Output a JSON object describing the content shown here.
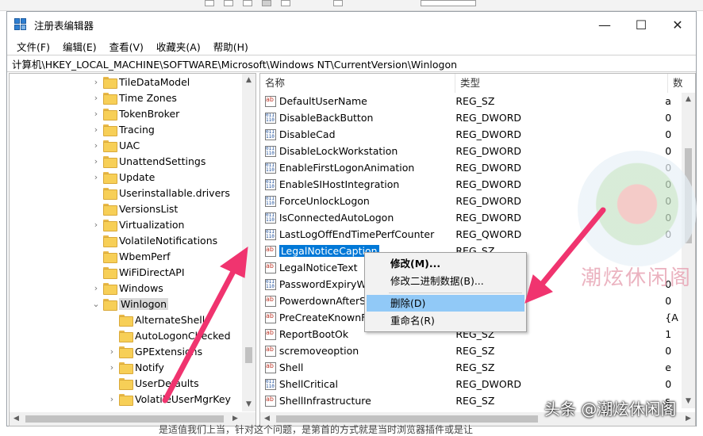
{
  "window": {
    "title": "注册表编辑器",
    "minimize": "—",
    "maximize": "☐",
    "close": "✕"
  },
  "menu": [
    "文件(F)",
    "编辑(E)",
    "查看(V)",
    "收藏夹(A)",
    "帮助(H)"
  ],
  "address": "计算机\\HKEY_LOCAL_MACHINE\\SOFTWARE\\Microsoft\\Windows NT\\CurrentVersion\\Winlogon",
  "tree": {
    "items": [
      {
        "label": "TileDataModel",
        "expander": "›"
      },
      {
        "label": "Time Zones",
        "expander": "›"
      },
      {
        "label": "TokenBroker",
        "expander": "›"
      },
      {
        "label": "Tracing",
        "expander": "›"
      },
      {
        "label": "UAC",
        "expander": "›"
      },
      {
        "label": "UnattendSettings",
        "expander": "›"
      },
      {
        "label": "Update",
        "expander": "›"
      },
      {
        "label": "Userinstallable.drivers",
        "expander": ""
      },
      {
        "label": "VersionsList",
        "expander": ""
      },
      {
        "label": "Virtualization",
        "expander": "›"
      },
      {
        "label": "VolatileNotifications",
        "expander": ""
      },
      {
        "label": "WbemPerf",
        "expander": ""
      },
      {
        "label": "WiFiDirectAPI",
        "expander": ""
      },
      {
        "label": "Windows",
        "expander": "›"
      },
      {
        "label": "Winlogon",
        "expander": "⌄"
      },
      {
        "label": "AlternateShells",
        "expander": ""
      },
      {
        "label": "AutoLogonChecked",
        "expander": ""
      },
      {
        "label": "GPExtensions",
        "expander": "›"
      },
      {
        "label": "Notify",
        "expander": "›"
      },
      {
        "label": "UserDefaults",
        "expander": ""
      },
      {
        "label": "VolatileUserMgrKey",
        "expander": "›"
      }
    ]
  },
  "list": {
    "headers": {
      "name": "名称",
      "type": "类型",
      "data": "数"
    },
    "rows": [
      {
        "name": "DefaultUserName",
        "type": "REG_SZ",
        "data": "a",
        "icon": "sz"
      },
      {
        "name": "DisableBackButton",
        "type": "REG_DWORD",
        "data": "0",
        "icon": "bin"
      },
      {
        "name": "DisableCad",
        "type": "REG_DWORD",
        "data": "0",
        "icon": "bin"
      },
      {
        "name": "DisableLockWorkstation",
        "type": "REG_DWORD",
        "data": "0",
        "icon": "bin"
      },
      {
        "name": "EnableFirstLogonAnimation",
        "type": "REG_DWORD",
        "data": "0",
        "icon": "bin"
      },
      {
        "name": "EnableSIHostIntegration",
        "type": "REG_DWORD",
        "data": "0",
        "icon": "bin"
      },
      {
        "name": "ForceUnlockLogon",
        "type": "REG_DWORD",
        "data": "0",
        "icon": "bin"
      },
      {
        "name": "IsConnectedAutoLogon",
        "type": "REG_DWORD",
        "data": "0",
        "icon": "bin"
      },
      {
        "name": "LastLogOffEndTimePerfCounter",
        "type": "REG_QWORD",
        "data": "0",
        "icon": "bin"
      },
      {
        "name": "LegalNoticeCaption",
        "type": "REG_SZ",
        "data": "",
        "icon": "sz"
      },
      {
        "name": "LegalNoticeText",
        "type": "",
        "data": "",
        "icon": "sz"
      },
      {
        "name": "PasswordExpiryWar",
        "type": "",
        "data": "0",
        "icon": "bin"
      },
      {
        "name": "PowerdownAfterShu",
        "type": "",
        "data": "0",
        "icon": "sz"
      },
      {
        "name": "PreCreateKnownFold",
        "type": "",
        "data": "{A",
        "icon": "sz"
      },
      {
        "name": "ReportBootOk",
        "type": "REG_SZ",
        "data": "1",
        "icon": "sz"
      },
      {
        "name": "scremoveoption",
        "type": "REG_SZ",
        "data": "0",
        "icon": "sz"
      },
      {
        "name": "Shell",
        "type": "REG_SZ",
        "data": "e",
        "icon": "sz"
      },
      {
        "name": "ShellCritical",
        "type": "REG_DWORD",
        "data": "0",
        "icon": "bin"
      },
      {
        "name": "ShellInfrastructure",
        "type": "REG_SZ",
        "data": "s",
        "icon": "sz"
      }
    ]
  },
  "context_menu": {
    "modify": "修改(M)...",
    "modify_binary": "修改二进制数据(B)...",
    "delete": "删除(D)",
    "rename": "重命名(R)"
  },
  "watermark": {
    "logo_text": "潮炫休闲阁",
    "bottom": "头条 @潮炫休闲阁"
  },
  "bottom_text": "是适值我们上当，针对这个问题，是第首的方式就是当时浏览器插件或是让"
}
